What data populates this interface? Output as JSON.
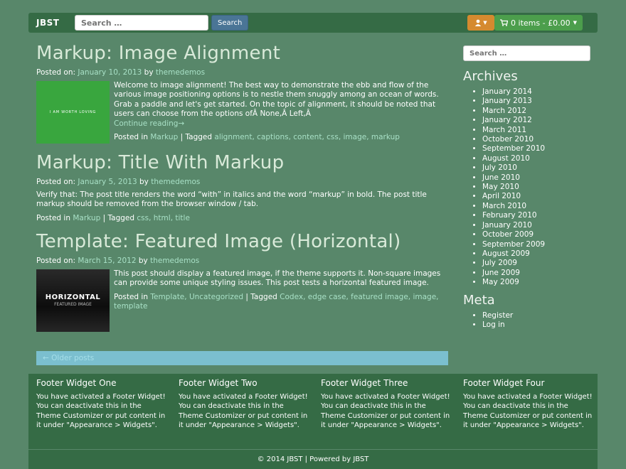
{
  "navbar": {
    "brand": "JBST",
    "search_placeholder": "Search …",
    "search_button": "Search",
    "user_icon": "user-icon",
    "cart_icon": "cart-icon",
    "cart_label": "0 items - £0.00"
  },
  "posts": [
    {
      "title": "Markup: Image Alignment",
      "posted_on_label": "Posted on:",
      "date": "January 10, 2013",
      "by": "by",
      "author": "themedemos",
      "thumb_text": "I AM WORTH LOVING",
      "excerpt": "Welcome to image alignment! The best way to demonstrate the ebb and flow of the various image positioning options is to nestle them snuggly among an ocean of words. Grab a paddle and let's get started. On the topic of alignment, it should be noted that users can choose from the options ofÂ None,Â Left,Â",
      "continue": "Continue reading→",
      "posted_in": "Posted in",
      "categories": "Markup",
      "tagged": "| Tagged",
      "tags": "alignment, captions, content, css, image, markup"
    },
    {
      "title": "Markup: Title With Markup",
      "posted_on_label": "Posted on:",
      "date": "January 5, 2013",
      "by": "by",
      "author": "themedemos",
      "excerpt": "Verify that: The post title renders the word “with” in italics and the word “markup” in bold. The post title markup should be removed from the browser window / tab.",
      "posted_in": "Posted in",
      "categories": "Markup",
      "tagged": "| Tagged",
      "tags": "css, html, title"
    },
    {
      "title": "Template: Featured Image (Horizontal)",
      "posted_on_label": "Posted on:",
      "date": "March 15, 2012",
      "by": "by",
      "author": "themedemos",
      "thumb_big": "HORIZONTAL",
      "thumb_small": "FEATURED IMAGE",
      "excerpt": "This post should display a featured image, if the theme supports it. Non-square images can provide some unique styling issues. This post tests a horizontal featured image.",
      "posted_in": "Posted in",
      "categories": "Template, Uncategorized",
      "tagged": "| Tagged",
      "tags": "Codex, edge case, featured image, image, template"
    }
  ],
  "older_posts": "← Older posts",
  "sidebar": {
    "search_placeholder": "Search …",
    "archives_title": "Archives",
    "archives": [
      "January 2014",
      "January 2013",
      "March 2012",
      "January 2012",
      "March 2011",
      "October 2010",
      "September 2010",
      "August 2010",
      "July 2010",
      "June 2010",
      "May 2010",
      "April 2010",
      "March 2010",
      "February 2010",
      "January 2010",
      "October 2009",
      "September 2009",
      "August 2009",
      "July 2009",
      "June 2009",
      "May 2009"
    ],
    "meta_title": "Meta",
    "meta": [
      "Register",
      "Log in"
    ]
  },
  "footer_widgets": [
    {
      "title": "Footer Widget One",
      "text": "You have activated a Footer Widget! You can deactivate this in the Theme Customizer or put content in it under \"Appearance > Widgets\"."
    },
    {
      "title": "Footer Widget Two",
      "text": "You have activated a Footer Widget! You can deactivate this in the Theme Customizer or put content in it under \"Appearance > Widgets\"."
    },
    {
      "title": "Footer Widget Three",
      "text": "You have activated a Footer Widget! You can deactivate this in the Theme Customizer or put content in it under \"Appearance > Widgets\"."
    },
    {
      "title": "Footer Widget Four",
      "text": "You have activated a Footer Widget! You can deactivate this in the Theme Customizer or put content in it under \"Appearance > Widgets\"."
    }
  ],
  "footer_bar": "© 2014 JBST | Powered by JBST",
  "colors": {
    "background": "#58876a",
    "navbar": "#356b45",
    "link": "#a8e0c6",
    "user_button": "#d58a2f",
    "cart_button": "#4c9e4c",
    "search_button": "#4a7596",
    "pager": "#7bbfcf"
  }
}
